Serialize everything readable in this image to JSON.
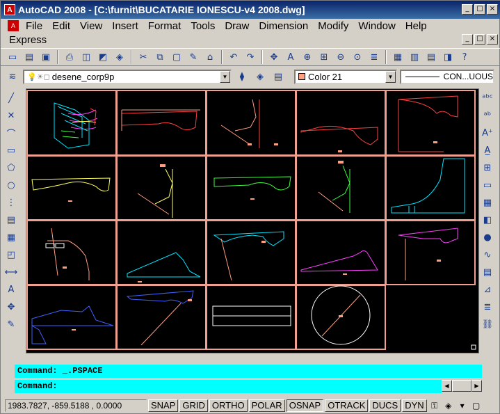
{
  "window": {
    "title": "AutoCAD 2008 - [C:\\furnit\\BUCATARIE IONESCU-v4 2008.dwg]",
    "minimize": "_",
    "maximize": "□",
    "close": "×"
  },
  "menu": {
    "row1": [
      "File",
      "Edit",
      "View",
      "Insert",
      "Format",
      "Tools",
      "Draw",
      "Dimension",
      "Modify",
      "Window",
      "Help"
    ],
    "row2": [
      "Express"
    ]
  },
  "layers": {
    "current_layer": "desene_corp9p",
    "color": "Color 21",
    "linetype": "CON...UOUS"
  },
  "command": {
    "history": "Command:  _.PSPACE",
    "prompt": "Command:"
  },
  "status": {
    "coordinates": "1983.7827, -859.5188 , 0.0000",
    "buttons": [
      {
        "label": "SNAP",
        "active": false
      },
      {
        "label": "GRID",
        "active": false
      },
      {
        "label": "ORTHO",
        "active": false
      },
      {
        "label": "POLAR",
        "active": false
      },
      {
        "label": "OSNAP",
        "active": true
      },
      {
        "label": "OTRACK",
        "active": false
      },
      {
        "label": "DUCS",
        "active": false
      },
      {
        "label": "DYN",
        "active": false
      }
    ]
  },
  "colors": {
    "title_bar": "#0a246a",
    "drawing_bg": "#000000",
    "viewport_border": "#f0a090",
    "command_bg": "#00ffff"
  }
}
